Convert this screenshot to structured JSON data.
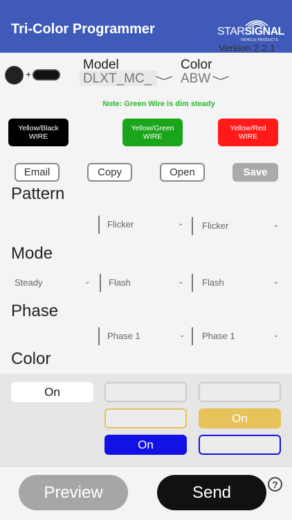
{
  "header": {
    "title": "Tri-Color Programmer",
    "logo_text_light": "STAR",
    "logo_text_bold": "SIGNAL",
    "logo_subtext": "VEHICLE PRODUCTS",
    "version": "Version 2.2.1",
    "background": "#3f5ab8"
  },
  "device": {
    "icon": "lightbar-device-icon",
    "plus": "+"
  },
  "model": {
    "label": "Model",
    "value": "DLXT_MC_"
  },
  "color_select": {
    "label": "Color",
    "value": "ABW"
  },
  "chevron": "﹀",
  "small_chevron": "⌄",
  "note": "Note: Green Wire is dim steady",
  "wires": [
    {
      "line1": "Yellow/Black",
      "line2": "WIRE",
      "color": "#000000"
    },
    {
      "line1": "Yellow/Green",
      "line2": "WIRE",
      "color": "#1aa51a"
    },
    {
      "line1": "Yellow/Red",
      "line2": "WIRE",
      "color": "#ff1a1a"
    }
  ],
  "actions": {
    "email": "Email",
    "copy": "Copy",
    "open": "Open",
    "save": "Save"
  },
  "sections": {
    "pattern": "Pattern",
    "mode": "Mode",
    "phase": "Phase",
    "color": "Color"
  },
  "pattern": {
    "col2": "Flicker",
    "col3": "Flicker"
  },
  "mode": {
    "col1": "Steady",
    "col2": "Flash",
    "col3": "Flash"
  },
  "phase": {
    "col2": "Phase 1",
    "col3": "Phase 1"
  },
  "colors": {
    "row1": {
      "col1": "On",
      "col2": "",
      "col3": ""
    },
    "row2": {
      "col2": "",
      "col3": "On"
    },
    "row3": {
      "col2": "On",
      "col3": ""
    },
    "amber": "#e6c25a",
    "blue": "#1212e6"
  },
  "footer": {
    "preview": "Preview",
    "send": "Send",
    "help": "?"
  }
}
